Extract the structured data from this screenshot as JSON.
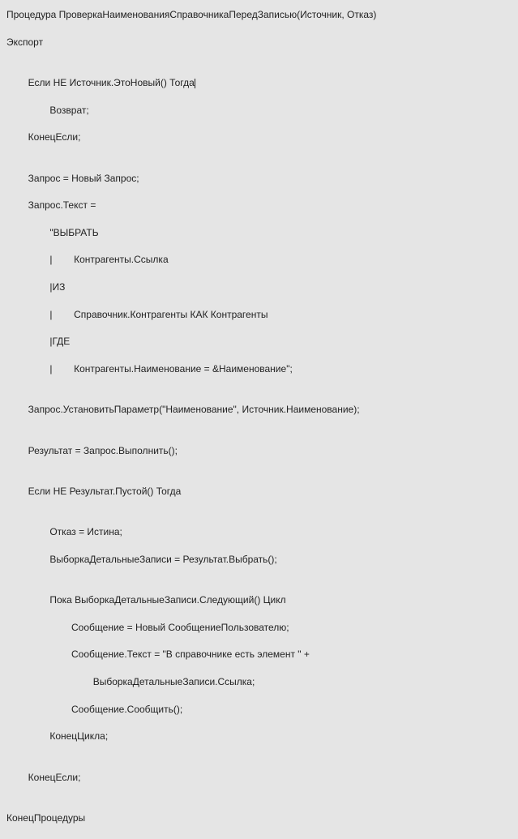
{
  "code": {
    "l01": "Процедура ПроверкаНаименованияСправочникаПередЗаписью(Источник, Отказ)",
    "l02": "Экспорт",
    "l03": "",
    "l04": "        Если НЕ Источник.ЭтоНовый() Тогда",
    "l05": "                Возврат;",
    "l06": "        КонецЕсли;",
    "l07": "",
    "l08": "        Запрос = Новый Запрос;",
    "l09": "        Запрос.Текст =",
    "l10": "                \"ВЫБРАТЬ",
    "l11": "                |        Контрагенты.Ссылка",
    "l12": "                |ИЗ",
    "l13": "                |        Справочник.Контрагенты КАК Контрагенты",
    "l14": "                |ГДЕ",
    "l15": "                |        Контрагенты.Наименование = &Наименование\";",
    "l16": "",
    "l17": "        Запрос.УстановитьПараметр(\"Наименование\", Источник.Наименование);",
    "l18": "",
    "l19": "        Результат = Запрос.Выполнить();",
    "l20": "",
    "l21": "        Если НЕ Результат.Пустой() Тогда",
    "l22": "",
    "l23": "                Отказ = Истина;",
    "l24": "                ВыборкаДетальныеЗаписи = Результат.Выбрать();",
    "l25": "",
    "l26": "                Пока ВыборкаДетальныеЗаписи.Следующий() Цикл",
    "l27": "                        Сообщение = Новый СообщениеПользователю;",
    "l28": "                        Сообщение.Текст = \"В справочнике есть элемент \" +",
    "l29": "                                ВыборкаДетальныеЗаписи.Ссылка;",
    "l30": "                        Сообщение.Сообщить();",
    "l31": "                КонецЦикла;",
    "l32": "",
    "l33": "        КонецЕсли;",
    "l34": "",
    "l35": "КонецПроцедуры"
  }
}
